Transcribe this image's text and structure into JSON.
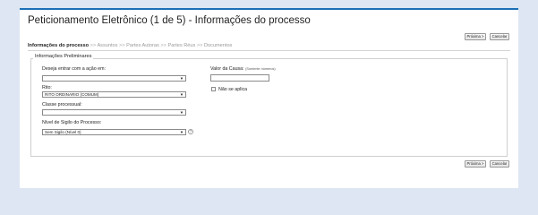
{
  "page": {
    "title": "Peticionamento Eletrônico (1 de 5) - Informações do processo"
  },
  "buttons": {
    "next": "Próxima >",
    "cancel": "Cancelar"
  },
  "steps": [
    {
      "label": "Informações do processo",
      "active": true
    },
    {
      "label": "Assuntos",
      "active": false
    },
    {
      "label": "Partes Autoras",
      "active": false
    },
    {
      "label": "Partes Réus",
      "active": false
    },
    {
      "label": "Documentos",
      "active": false
    }
  ],
  "step_separator": ">>",
  "section": {
    "legend": "Informações Preliminares"
  },
  "fields": {
    "court": {
      "label": "Deseja entrar com a ação em:",
      "value": ""
    },
    "rite": {
      "label": "Rito:",
      "value": "RITO ORDINARIO (COMUM)"
    },
    "class": {
      "label": "Classe processual:",
      "value": ""
    },
    "secrecy": {
      "label": "Nível de Sigilo do Processo:",
      "value": "Sem Sigilo (Nível 0)"
    },
    "cause_value": {
      "label": "Valor da Causa:",
      "hint": "(Somente números)",
      "value": ""
    },
    "not_applicable": {
      "label": "Não se aplica",
      "checked": false
    }
  },
  "icons": {
    "dropdown": "chevron-down-icon",
    "help": "help-icon"
  },
  "colors": {
    "accent": "#1c6fb5",
    "background": "#dde6f2"
  }
}
